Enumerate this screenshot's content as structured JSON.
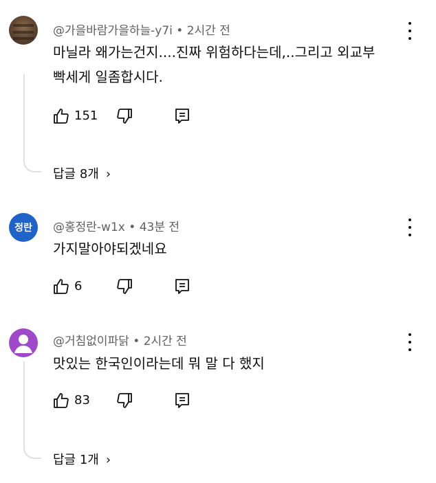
{
  "comments": [
    {
      "author": "@가을바람가을하늘-y7i",
      "time": "2시간 전",
      "text_lines": [
        "마닐라 왜가는건지....진짜 위험하다는데,..그리고 외교부",
        "빡세게 일좀합시다."
      ],
      "likes": "151",
      "replies": "답글 8개"
    },
    {
      "author": "@홍정란-w1x",
      "time": "43분 전",
      "avatar_text": "정란",
      "text_lines": [
        "가지말아야되겠네요"
      ],
      "likes": "6"
    },
    {
      "author": "@거침없이파닭",
      "time": "2시간 전",
      "text_lines": [
        "맛있는 한국인이라는데 뭐 말 다 했지"
      ],
      "likes": "83",
      "replies": "답글 1개"
    }
  ],
  "separator": " • ",
  "chevron": "›",
  "icons": [
    "like-icon",
    "dislike-icon",
    "reply-icon",
    "more-vertical-icon"
  ],
  "colors": {
    "avatar_blue": "#1f63c8",
    "avatar_purple": "#9f49c9",
    "meta_gray": "#606060"
  }
}
